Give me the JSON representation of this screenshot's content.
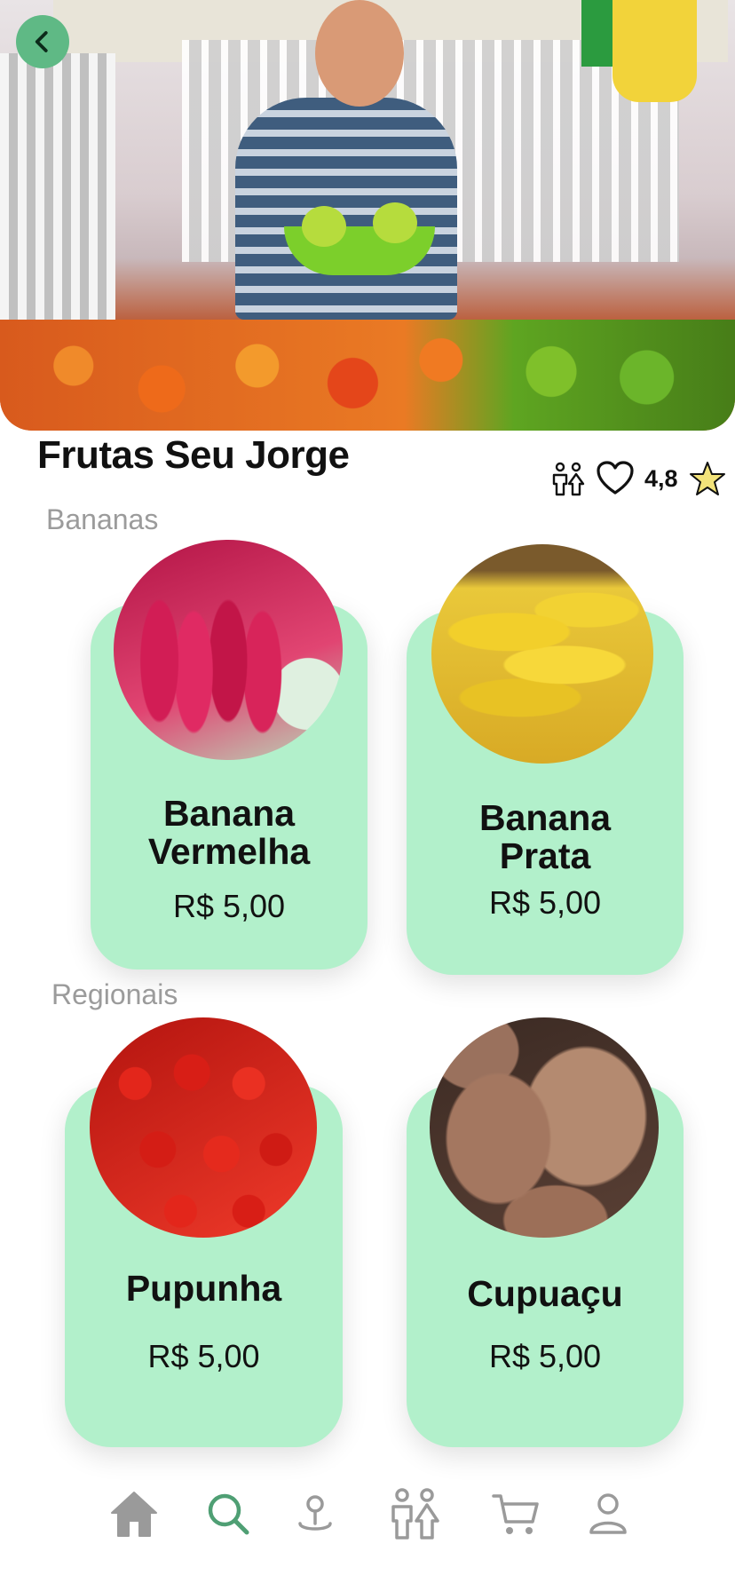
{
  "store": {
    "name": "Frutas Seu Jorge",
    "rating": "4,8",
    "icons": [
      "family-icon",
      "heart-icon",
      "star-icon"
    ]
  },
  "colors": {
    "card": "#b2f0cb",
    "accent": "#5fb985",
    "star": "#f3e37a",
    "nav_active": "#4f9f74",
    "nav_inactive": "#9a9a9a"
  },
  "sections": [
    {
      "label": "Bananas",
      "products": [
        {
          "name_line1": "Banana",
          "name_line2": "Vermelha",
          "price": "R$ 5,00"
        },
        {
          "name_line1": "Banana",
          "name_line2": "Prata",
          "price": "R$ 5,00"
        }
      ]
    },
    {
      "label": "Regionais",
      "products": [
        {
          "name_line1": "Pupunha",
          "price": "R$ 5,00"
        },
        {
          "name_line1": "Cupuaçu",
          "price": "R$ 5,00"
        }
      ]
    }
  ],
  "nav": {
    "active": "search",
    "items": [
      "home-icon",
      "search-icon",
      "map-pin-icon",
      "family-icon",
      "cart-icon",
      "user-icon"
    ]
  }
}
